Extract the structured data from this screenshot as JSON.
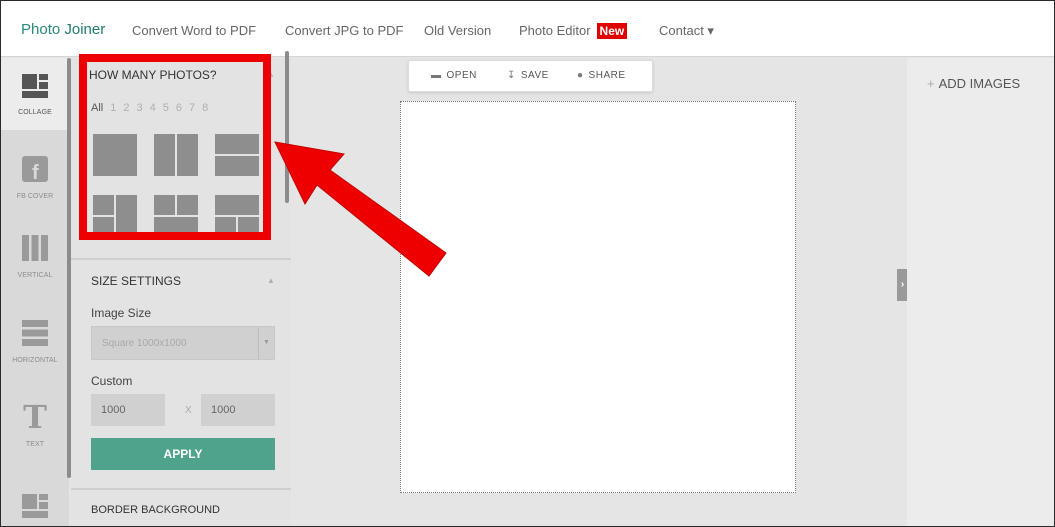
{
  "topnav": {
    "brand_prefix": "Photo ",
    "brand_suffix": "Joiner",
    "links": [
      {
        "label": "Convert Word to PDF"
      },
      {
        "label": "Convert JPG to PDF"
      },
      {
        "label": "Old Version"
      },
      {
        "label": "Photo Editor"
      },
      {
        "label": "Contact ▾"
      }
    ],
    "new_badge": "New"
  },
  "rail": {
    "items": [
      {
        "label": "COLLAGE",
        "icon": "collage-icon"
      },
      {
        "label": "FB COVER",
        "icon": "facebook-icon"
      },
      {
        "label": "VERTICAL",
        "icon": "vertical-icon"
      },
      {
        "label": "HORIZONTAL",
        "icon": "horizontal-icon"
      },
      {
        "label": "TEXT",
        "icon": "text-icon"
      }
    ]
  },
  "panel": {
    "how_many_title": "HOW MANY PHOTOS?",
    "counts": [
      "All",
      "1",
      "2",
      "3",
      "4",
      "5",
      "6",
      "7",
      "8"
    ],
    "size_title": "SIZE SETTINGS",
    "image_size_label": "Image Size",
    "image_size_value": "Square 1000x1000",
    "custom_label": "Custom",
    "width_value": "1000",
    "times": "X",
    "height_value": "1000",
    "apply_label": "APPLY",
    "next_section": "BORDER BACKGROUND"
  },
  "toolbar": {
    "open": "OPEN",
    "save": "SAVE",
    "share": "SHARE"
  },
  "right": {
    "add_images": "ADD IMAGES"
  },
  "colors": {
    "accent": "#4fa28b",
    "brand": "#2b8a7a",
    "highlight": "#ee0000"
  }
}
